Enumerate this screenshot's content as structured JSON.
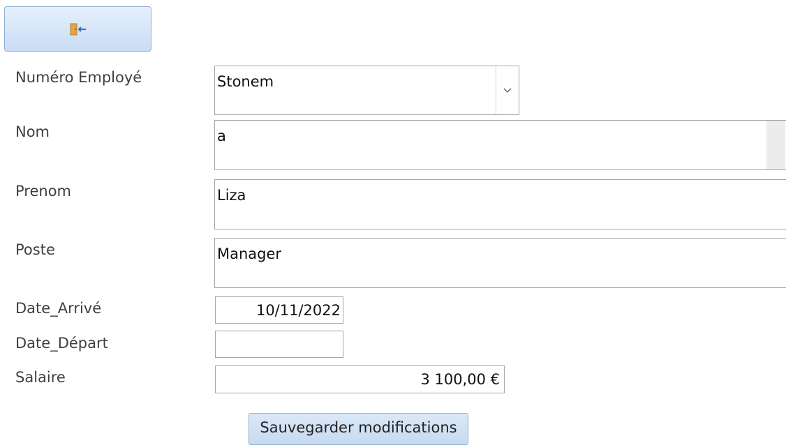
{
  "toolbar": {
    "exit_icon": "exit-door-icon"
  },
  "form": {
    "employee_number": {
      "label": "Numéro Employé",
      "value": "Stonem",
      "arrow_icon": "chevron-down-icon"
    },
    "nom": {
      "label": "Nom",
      "value": "a"
    },
    "prenom": {
      "label": "Prenom",
      "value": "Liza"
    },
    "poste": {
      "label": "Poste",
      "value": "Manager"
    },
    "date_arrive": {
      "label": "Date_Arrivé",
      "value": "10/11/2022"
    },
    "date_depart": {
      "label": "Date_Départ",
      "value": ""
    },
    "salaire": {
      "label": "Salaire",
      "value": "3 100,00 €"
    }
  },
  "actions": {
    "save_label": "Sauvegarder modifications"
  },
  "colors": {
    "button_border": "#8eaed6",
    "button_fill": "#c9dcf4",
    "field_border": "#a3a3a3"
  }
}
